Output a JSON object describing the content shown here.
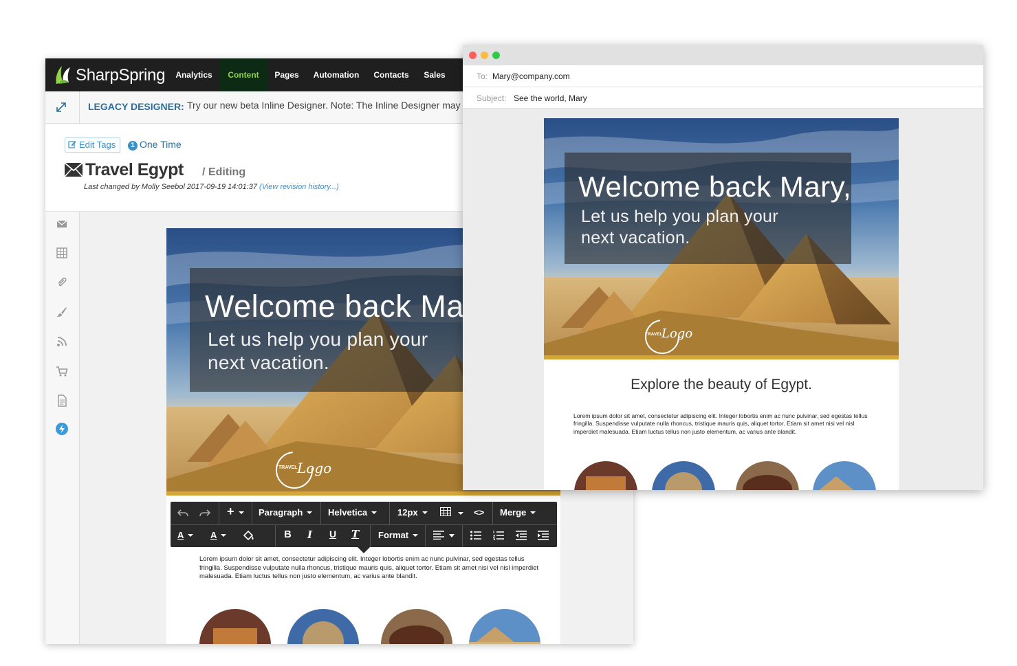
{
  "editor": {
    "brand": "SharpSpring",
    "nav": [
      {
        "label": "Analytics",
        "active": false
      },
      {
        "label": "Content",
        "active": true
      },
      {
        "label": "Pages",
        "active": false
      },
      {
        "label": "Automation",
        "active": false
      },
      {
        "label": "Contacts",
        "active": false
      },
      {
        "label": "Sales",
        "active": false
      }
    ],
    "legacy_label": "LEGACY DESIGNER:",
    "legacy_text": "Try our new beta Inline Designer. Note: The Inline Designer may r",
    "edit_tags": "Edit Tags",
    "one_time_badge": "1",
    "one_time": "One Time",
    "title": "Travel Egypt",
    "status": "/ Editing",
    "last_changed": "Last changed by Molly Seebol 2017-09-19 14:01:37",
    "revision_link": "(View revision history...)",
    "rail_icons": [
      "envelope-icon",
      "grid-icon",
      "paperclip-icon",
      "brush-icon",
      "rss-icon",
      "cart-icon",
      "document-icon",
      "bolt-icon"
    ],
    "email": {
      "hero_title": "Welcome back Ma",
      "hero_sub": "Let us help you plan your\nnext vacation.",
      "logo_small": "TRAVEL",
      "logo_script": "Logo",
      "body": "Lorem ipsum dolor sit amet, consectetur adipiscing elit. Integer lobortis enim ac nunc pulvinar, sed egestas tellus fringilla. Suspendisse vulputate nulla rhoncus, tristique mauris quis, aliquet tortor. Etiam sit amet nisi vel nisl imperdiet malesuada. Etiam luctus tellus non justo elementum, ac varius ante blandit."
    },
    "toolbar": {
      "paragraph": "Paragraph",
      "font": "Helvetica",
      "size": "12px",
      "merge": "Merge",
      "format": "Format",
      "bold": "B",
      "italic": "I",
      "underline": "U",
      "clear": "T",
      "text_color": "A",
      "bg_color": "A",
      "code": "<>"
    }
  },
  "mail": {
    "to_label": "To:",
    "to_value": "Mary@company.com",
    "subject_label": "Subject:",
    "subject_value": "See the world, Mary",
    "email": {
      "hero_title": "Welcome back Mary,",
      "hero_sub": "Let us help you plan your\nnext vacation.",
      "logo_small": "TRAVEL",
      "logo_script": "Logo",
      "heading": "Explore the beauty of Egypt.",
      "body": "Lorem ipsum dolor sit amet, consectetur adipiscing elit. Integer lobortis enim ac nunc pulvinar, sed egestas tellus fringilla. Suspendisse vulputate nulla rhoncus, tristique mauris quis, aliquet tortor. Etiam sit amet nisi vel nisl imperdiet malesuada. Etiam luctus tellus non justo elementum, ac varius ante blandit."
    }
  },
  "colors": {
    "nav_bg": "#1f1f1f",
    "nav_active_text": "#8fd44a",
    "link_blue": "#3b8fc7",
    "gold": "#d4a637",
    "dot_red": "#fc605c",
    "dot_yellow": "#fdbc40",
    "dot_green": "#34c84a"
  }
}
